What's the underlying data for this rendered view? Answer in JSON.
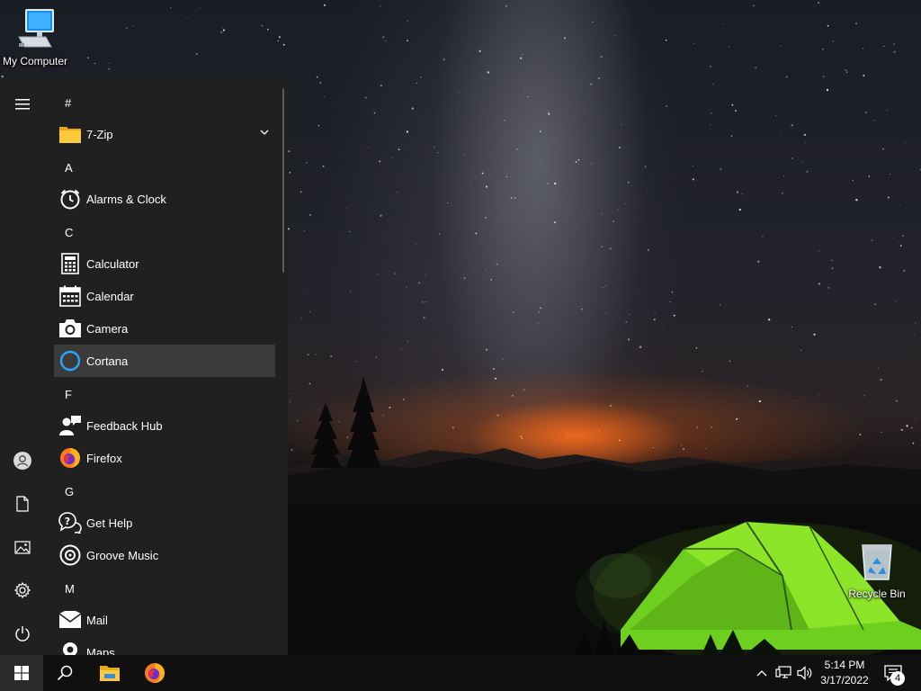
{
  "desktop": {
    "icons": [
      {
        "label": "My Computer",
        "icon": "computer-icon"
      },
      {
        "label": "Recycle Bin",
        "icon": "recycle-bin-icon"
      }
    ],
    "wallpaper": "night-sky-tent"
  },
  "start_menu": {
    "rail": [
      {
        "name": "expand-menu",
        "icon": "hamburger-icon"
      },
      {
        "name": "account",
        "icon": "user-icon"
      },
      {
        "name": "documents",
        "icon": "document-icon"
      },
      {
        "name": "pictures",
        "icon": "pictures-icon"
      },
      {
        "name": "settings",
        "icon": "gear-icon"
      },
      {
        "name": "power",
        "icon": "power-icon"
      }
    ],
    "groups": {
      "hash": "#",
      "a": "A",
      "c": "C",
      "f": "F",
      "g": "G",
      "m": "M"
    },
    "apps": {
      "zip": "7-Zip",
      "alarms": "Alarms & Clock",
      "calculator": "Calculator",
      "calendar": "Calendar",
      "camera": "Camera",
      "cortana": "Cortana",
      "feedback": "Feedback Hub",
      "firefox": "Firefox",
      "gethelp": "Get Help",
      "groove": "Groove Music",
      "mail": "Mail",
      "maps": "Maps"
    },
    "selected_app": "Cortana"
  },
  "taskbar": {
    "pinned": [
      {
        "name": "start",
        "icon": "windows-logo-icon"
      },
      {
        "name": "search",
        "icon": "search-icon"
      },
      {
        "name": "file-explorer",
        "icon": "folder-icon"
      },
      {
        "name": "firefox",
        "icon": "firefox-icon"
      }
    ],
    "tray": {
      "time": "5:14 PM",
      "date": "3/17/2022",
      "notification_count": "4"
    }
  },
  "colors": {
    "start_bg": "#202020",
    "taskbar_bg": "#101010",
    "selected_bg": "#3b3b3b",
    "accent": "#0078d7"
  }
}
